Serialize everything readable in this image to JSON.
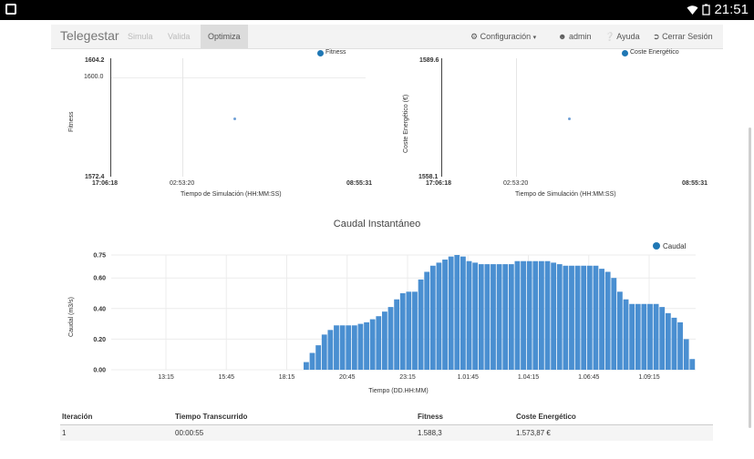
{
  "status_bar": {
    "time": "21:51",
    "wifi_icon": "wifi-icon",
    "battery_icon": "battery-icon"
  },
  "navbar": {
    "brand": "Telegestar",
    "tabs": [
      {
        "label": "Simula"
      },
      {
        "label": "Valida"
      },
      {
        "label": "Optimiza"
      }
    ],
    "config_label": "Configuración",
    "user_label": "admin",
    "help_label": "Ayuda",
    "logout_label": "Cerrar Sesión"
  },
  "fitness_chart": {
    "legend": "Fitness",
    "ylabel": "Fitness",
    "xlabel": "Tiempo de Simulación (HH:MM:SS)",
    "y_top": "1604.2",
    "y_tick": "1600.0",
    "y_bottom": "1572.4",
    "x_start": "17:06:18",
    "x_mid": "02:53:20",
    "x_end": "08:55:31"
  },
  "coste_chart": {
    "legend": "Coste Energético",
    "ylabel": "Coste Energético (€)",
    "xlabel": "Tiempo de Simulación (HH:MM:SS)",
    "y_top": "1589.6",
    "y_bottom": "1558.1",
    "x_start": "17:06:18",
    "x_mid": "02:53:20",
    "x_end": "08:55:31"
  },
  "chart_data": {
    "type": "bar",
    "title": "Caudal Instantáneo",
    "xlabel": "Tiempo (DD.HH:MM)",
    "ylabel": "Caudal (m3/s)",
    "legend": "Caudal",
    "ylim": [
      0,
      0.75
    ],
    "y_ticks": [
      "0.00",
      "0.20",
      "0.40",
      "0.60",
      "0.75"
    ],
    "x_ticks": [
      "13:15",
      "15:45",
      "18:15",
      "20:45",
      "23:15",
      "1.01:45",
      "1.04:15",
      "1.06:45",
      "1.09:15"
    ],
    "values": [
      0.05,
      0.11,
      0.16,
      0.23,
      0.26,
      0.29,
      0.29,
      0.29,
      0.29,
      0.3,
      0.31,
      0.33,
      0.35,
      0.38,
      0.41,
      0.46,
      0.5,
      0.51,
      0.51,
      0.59,
      0.64,
      0.68,
      0.7,
      0.72,
      0.74,
      0.75,
      0.74,
      0.71,
      0.7,
      0.69,
      0.69,
      0.69,
      0.69,
      0.69,
      0.69,
      0.71,
      0.71,
      0.71,
      0.71,
      0.71,
      0.71,
      0.7,
      0.69,
      0.68,
      0.68,
      0.68,
      0.68,
      0.68,
      0.68,
      0.66,
      0.64,
      0.6,
      0.51,
      0.46,
      0.43,
      0.43,
      0.43,
      0.43,
      0.43,
      0.41,
      0.37,
      0.34,
      0.31,
      0.2,
      0.07
    ]
  },
  "table": {
    "headers": [
      "Iteración",
      "Tiempo Transcurrido",
      "Fitness",
      "Coste Energético"
    ],
    "rows": [
      [
        "1",
        "00:00:55",
        "1.588,3",
        "1.573,87 €"
      ]
    ]
  },
  "colors": {
    "bar": "#4a8fd1",
    "accent": "#1f77b4"
  }
}
